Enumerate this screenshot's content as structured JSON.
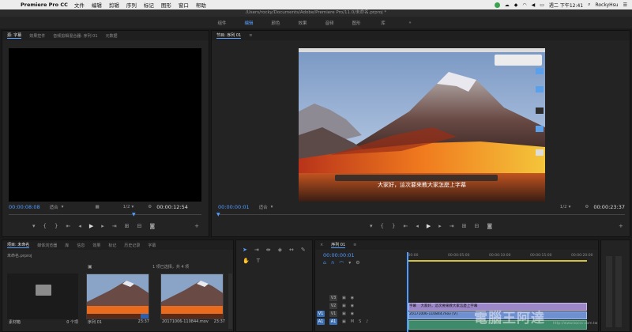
{
  "menubar": {
    "app_name": "Premiere Pro CC",
    "items": [
      "文件",
      "编辑",
      "剪辑",
      "序列",
      "标记",
      "图形",
      "窗口",
      "帮助"
    ],
    "datetime": "週二 下午12:41",
    "user": "RockyHsu"
  },
  "window": {
    "title": "/Users/rocky/Documents/Adobe/Premiere Pro/11.0/未命名.prproj *"
  },
  "workspaces": [
    "组件",
    "编辑",
    "颜色",
    "效果",
    "音频",
    "图形",
    "库",
    "»"
  ],
  "source": {
    "tabs": [
      "源: 字幕",
      "效果控件",
      "音频剪辑混合器: 序列 01",
      "元数据"
    ],
    "timecode_in": "00:00:08:08",
    "fit": "适合",
    "ratio": "1/2",
    "timecode_out": "00:00:12:54"
  },
  "program": {
    "tab": "节目: 序列 01",
    "subtitle": "大家好，這次要來教大家怎麼上字幕",
    "timecode_in": "00:00:00:01",
    "fit": "适合",
    "ratio": "1/2",
    "timecode_out": "00:00:23:37"
  },
  "project": {
    "tabs": [
      "项目: 未命名",
      "媒体浏览器",
      "库",
      "信息",
      "效果",
      "标记",
      "历史记录",
      "字幕"
    ],
    "file": "未命名.prproj",
    "selection_info": "1 项已选择，共 4 项",
    "items": [
      {
        "name": "素材箱",
        "meta": "0 个项"
      },
      {
        "name": "序列 01",
        "meta": "23:37"
      },
      {
        "name": "20171006-110844.mov",
        "meta": "23:37"
      }
    ]
  },
  "timeline": {
    "tab": "序列 01",
    "timecode": "00:00:00:01",
    "ruler": [
      ":00:00",
      "00:00:05:00",
      "00:00:10:00",
      "00:00:15:00",
      "00:00:20:00"
    ],
    "tracks": [
      "V3",
      "V2",
      "V1",
      "A1"
    ],
    "clip_subtitle": "字幕",
    "clip_subtitle_text": "大家好，這次要來教大家怎麼上字幕",
    "clip_video": "20171006-110844.mov [V]"
  },
  "watermark": {
    "name": "電腦王阿達",
    "url": "http://www.koccc.com.tw"
  },
  "colors": {
    "accent": "#4f9bff",
    "clip_purple": "#9c87c9",
    "clip_blue": "#6e8fd0",
    "yellow": "#d5c13a"
  }
}
